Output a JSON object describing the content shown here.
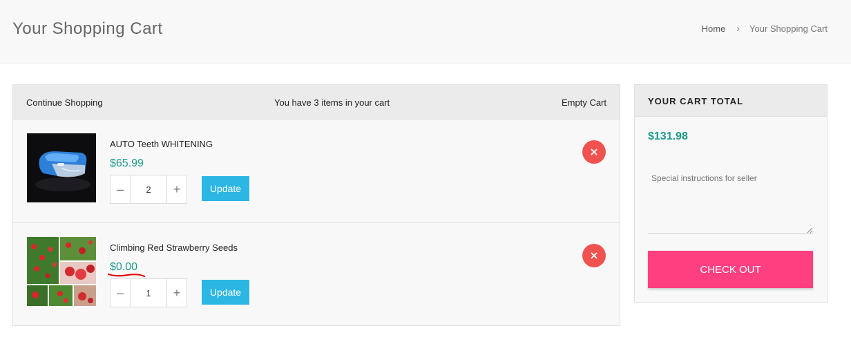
{
  "header": {
    "title": "Your Shopping Cart",
    "breadcrumb": {
      "home": "Home",
      "separator": "›",
      "current": "Your Shopping Cart"
    }
  },
  "cart": {
    "continue_label": "Continue Shopping",
    "count_text": "You have 3 items in your cart",
    "empty_label": "Empty Cart",
    "items": [
      {
        "name": "AUTO Teeth WHITENING",
        "price": "$65.99",
        "quantity": "2",
        "update_label": "Update",
        "remove_icon": "close-icon",
        "image_desc": "teeth-whitening-device"
      },
      {
        "name": "Climbing Red Strawberry Seeds",
        "price": "$0.00",
        "quantity": "1",
        "update_label": "Update",
        "remove_icon": "close-icon",
        "image_desc": "strawberry-plants"
      }
    ]
  },
  "summary": {
    "heading": "YOUR CART TOTAL",
    "total": "$131.98",
    "notes_placeholder": "Special instructions for seller",
    "checkout_label": "CHECK OUT"
  },
  "colors": {
    "accent_green": "#1a9a8a",
    "update_blue": "#2bb6e3",
    "remove_red": "#f0524f",
    "checkout_pink": "#ff3f7f"
  }
}
